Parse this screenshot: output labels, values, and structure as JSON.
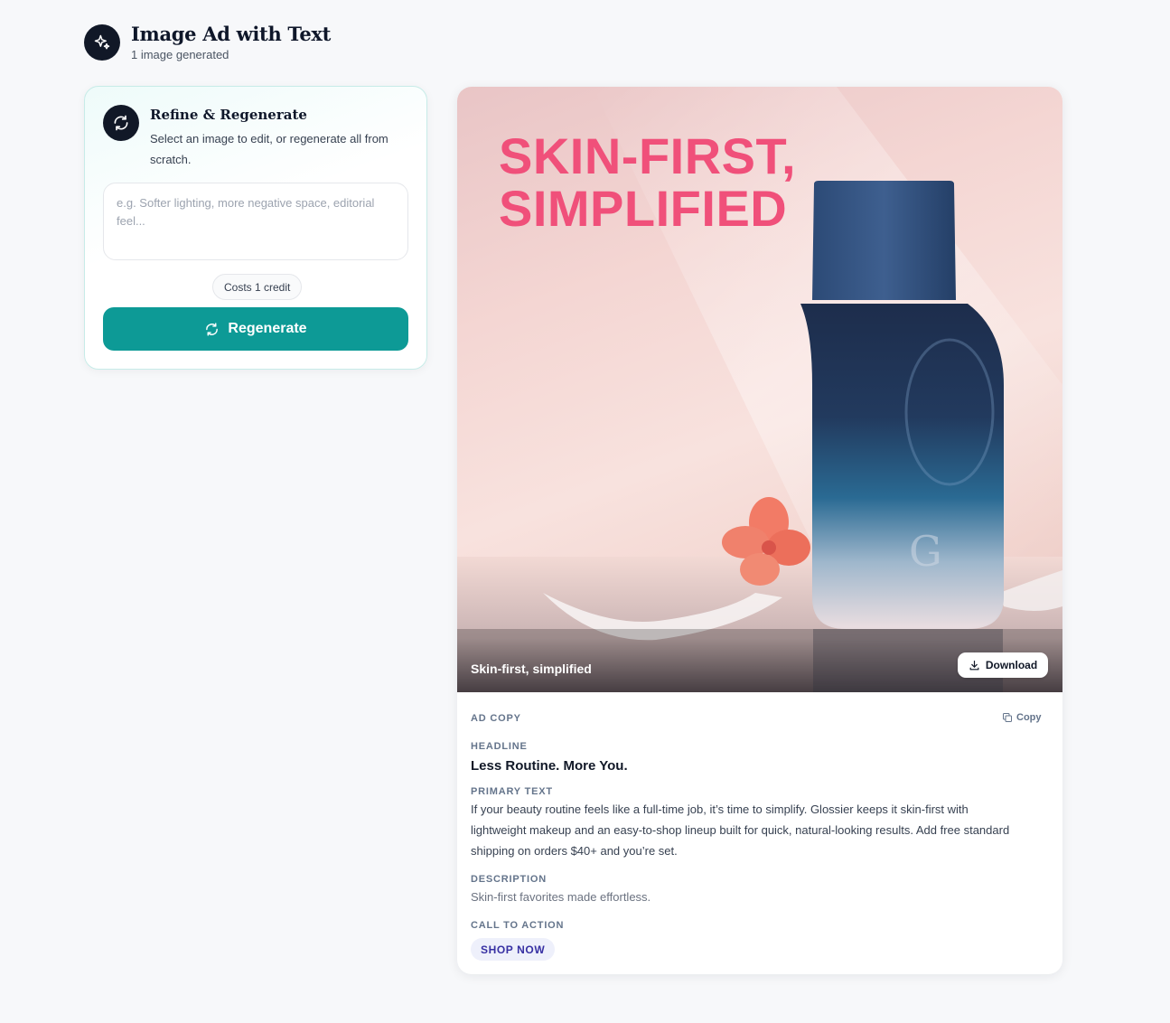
{
  "header": {
    "icon": "sparkles-icon",
    "title": "Image Ad with Text",
    "subtitle": "1 image generated"
  },
  "refine": {
    "icon": "refresh-icon",
    "title": "Refine & Regenerate",
    "description": "Select an image to edit, or regenerate all from scratch.",
    "input_placeholder": "e.g. Softer lighting, more negative space, editorial feel...",
    "input_value": "",
    "cost_label": "Costs 1 credit",
    "button_label": "Regenerate"
  },
  "result": {
    "image": {
      "headline_overlay": "SKIN-FIRST, SIMPLIFIED",
      "caption": "Skin-first, simplified",
      "download_label": "Download"
    },
    "ad_copy": {
      "section_label": "AD COPY",
      "copy_label": "Copy",
      "headline_label": "HEADLINE",
      "headline": "Less Routine. More You.",
      "primary_text_label": "PRIMARY TEXT",
      "primary_text": "If your beauty routine feels like a full-time job, it’s time to simplify. Glossier keeps it skin-first with lightweight makeup and an easy-to-shop lineup built for quick, natural-looking results. Add free standard shipping on orders $40+ and you’re set.",
      "description_label": "DESCRIPTION",
      "description": "Skin-first favorites made effortless.",
      "cta_label": "CALL TO ACTION",
      "cta": "SHOP NOW"
    }
  },
  "colors": {
    "accent": "#0d9a96",
    "headline_pink": "#f0507a",
    "cta_text": "#3730a3"
  }
}
